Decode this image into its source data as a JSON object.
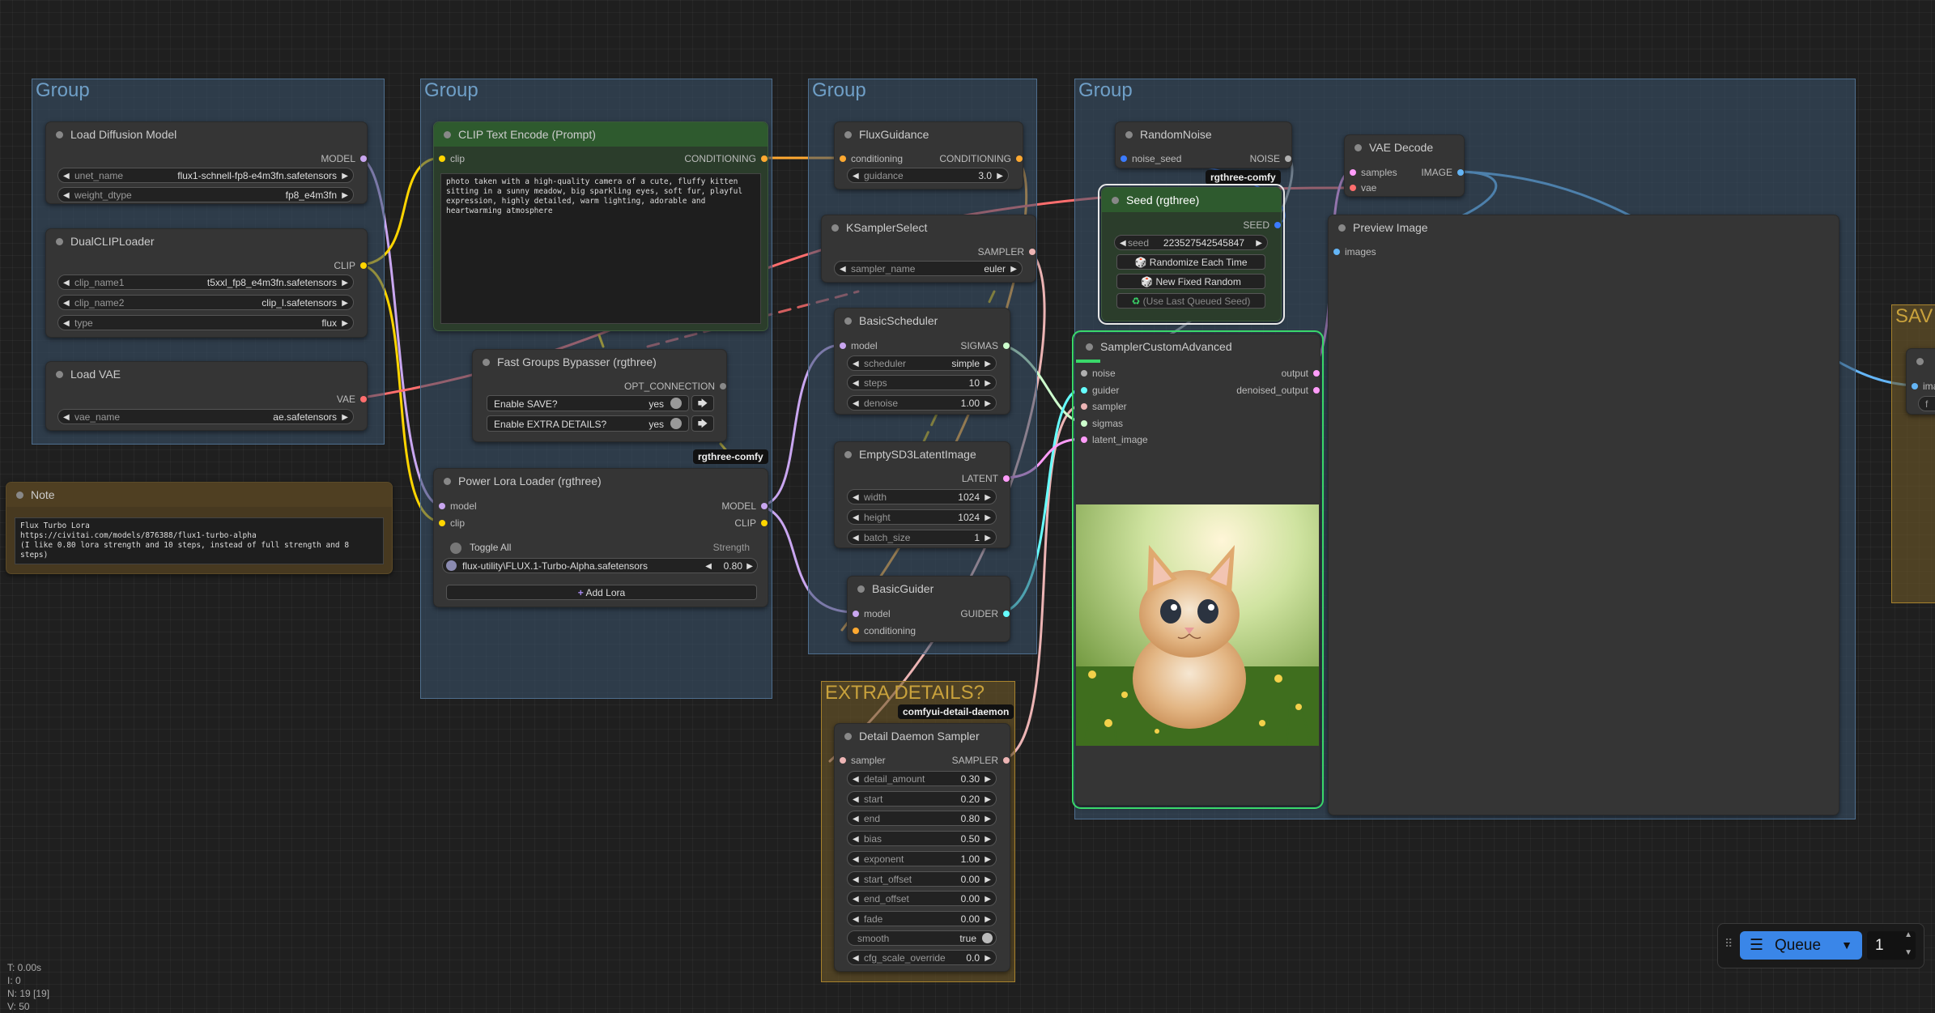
{
  "groups": {
    "g1": "Group",
    "g2": "Group",
    "g3": "Group",
    "g4": "Group",
    "extra": "EXTRA DETAILS?",
    "save": "SAV"
  },
  "colors": {
    "model": "#c9a6f0",
    "clip": "#ffd500",
    "vae": "#ff6e6e",
    "conditioning": "#ffa931",
    "latent": "#ff9cf9",
    "noise": "#b0b0b0",
    "sampler": "#ecb4b4",
    "sigmas": "#cdffcd",
    "guider": "#66ffff",
    "image": "#64b5f6",
    "seed": "#3b7bff"
  },
  "load_diffusion": {
    "title": "Load Diffusion Model",
    "out": "MODEL",
    "w1_label": "unet_name",
    "w1_value": "flux1-schnell-fp8-e4m3fn.safetensors",
    "w2_label": "weight_dtype",
    "w2_value": "fp8_e4m3fn"
  },
  "dualclip": {
    "title": "DualCLIPLoader",
    "out": "CLIP",
    "w1_label": "clip_name1",
    "w1_value": "t5xxl_fp8_e4m3fn.safetensors",
    "w2_label": "clip_name2",
    "w2_value": "clip_l.safetensors",
    "w3_label": "type",
    "w3_value": "flux"
  },
  "loadvae": {
    "title": "Load VAE",
    "out": "VAE",
    "w1_label": "vae_name",
    "w1_value": "ae.safetensors"
  },
  "note": {
    "title": "Note",
    "text": "Flux Turbo Lora\nhttps://civitai.com/models/876388/flux1-turbo-alpha\n(I like 0.80 lora strength and 10 steps, instead of full strength and 8 steps)"
  },
  "clip_encode": {
    "title": "CLIP Text Encode (Prompt)",
    "in": "clip",
    "out": "CONDITIONING",
    "text": "photo taken with a high-quality camera of a cute, fluffy kitten sitting in a sunny meadow, big sparkling eyes, soft fur, playful expression, highly detailed, warm lighting, adorable and heartwarming atmosphere"
  },
  "bypasser": {
    "title": "Fast Groups Bypasser (rgthree)",
    "out": "OPT_CONNECTION",
    "t1_label": "Enable SAVE?",
    "t1_value": "yes",
    "t2_label": "Enable EXTRA DETAILS?",
    "t2_value": "yes",
    "badge": "rgthree-comfy"
  },
  "power_lora": {
    "title": "Power Lora Loader (rgthree)",
    "in1": "model",
    "in2": "clip",
    "out1": "MODEL",
    "out2": "CLIP",
    "toggle_all": "Toggle All",
    "strength": "Strength",
    "lora_name": "flux-utility\\FLUX.1-Turbo-Alpha.safetensors",
    "lora_value": "0.80",
    "add_lora": "Add Lora"
  },
  "flux_guidance": {
    "title": "FluxGuidance",
    "in": "conditioning",
    "out": "CONDITIONING",
    "w1_label": "guidance",
    "w1_value": "3.0"
  },
  "ksampler_select": {
    "title": "KSamplerSelect",
    "out": "SAMPLER",
    "w1_label": "sampler_name",
    "w1_value": "euler"
  },
  "basic_scheduler": {
    "title": "BasicScheduler",
    "in": "model",
    "out": "SIGMAS",
    "w1_label": "scheduler",
    "w1_value": "simple",
    "w2_label": "steps",
    "w2_value": "10",
    "w3_label": "denoise",
    "w3_value": "1.00"
  },
  "empty_latent": {
    "title": "EmptySD3LatentImage",
    "out": "LATENT",
    "w1_label": "width",
    "w1_value": "1024",
    "w2_label": "height",
    "w2_value": "1024",
    "w3_label": "batch_size",
    "w3_value": "1"
  },
  "basic_guider": {
    "title": "BasicGuider",
    "in1": "model",
    "in2": "conditioning",
    "out": "GUIDER"
  },
  "detail_daemon": {
    "badge": "comfyui-detail-daemon",
    "title": "Detail Daemon Sampler",
    "in": "sampler",
    "out": "SAMPLER",
    "rows": [
      {
        "label": "detail_amount",
        "value": "0.30"
      },
      {
        "label": "start",
        "value": "0.20"
      },
      {
        "label": "end",
        "value": "0.80"
      },
      {
        "label": "bias",
        "value": "0.50"
      },
      {
        "label": "exponent",
        "value": "1.00"
      },
      {
        "label": "start_offset",
        "value": "0.00"
      },
      {
        "label": "end_offset",
        "value": "0.00"
      },
      {
        "label": "fade",
        "value": "0.00"
      }
    ],
    "smooth_label": "smooth",
    "smooth_value": "true",
    "cfg_label": "cfg_scale_override",
    "cfg_value": "0.0"
  },
  "random_noise": {
    "title": "RandomNoise",
    "in": "noise_seed",
    "out": "NOISE",
    "badge": "rgthree-comfy"
  },
  "seed": {
    "title": "Seed (rgthree)",
    "out": "SEED",
    "w1_label": "seed",
    "w1_value": "223527542545847",
    "b1": "Randomize Each Time",
    "b2": "New Fixed Random",
    "b3": "(Use Last Queued Seed)"
  },
  "sampler_adv": {
    "title": "SamplerCustomAdvanced",
    "in1": "noise",
    "in2": "guider",
    "in3": "sampler",
    "in4": "sigmas",
    "in5": "latent_image",
    "out1": "output",
    "out2": "denoised_output"
  },
  "vae_decode": {
    "title": "VAE Decode",
    "in1": "samples",
    "in2": "vae",
    "out": "IMAGE"
  },
  "preview": {
    "title": "Preview Image",
    "in": "images"
  },
  "save_node": {
    "in": "ima",
    "w": "f"
  },
  "status": {
    "t": "T: 0.00s",
    "i": "I: 0",
    "n": "N: 19 [19]",
    "v": "V: 50"
  },
  "queue": {
    "label": "Queue",
    "count": "1"
  }
}
